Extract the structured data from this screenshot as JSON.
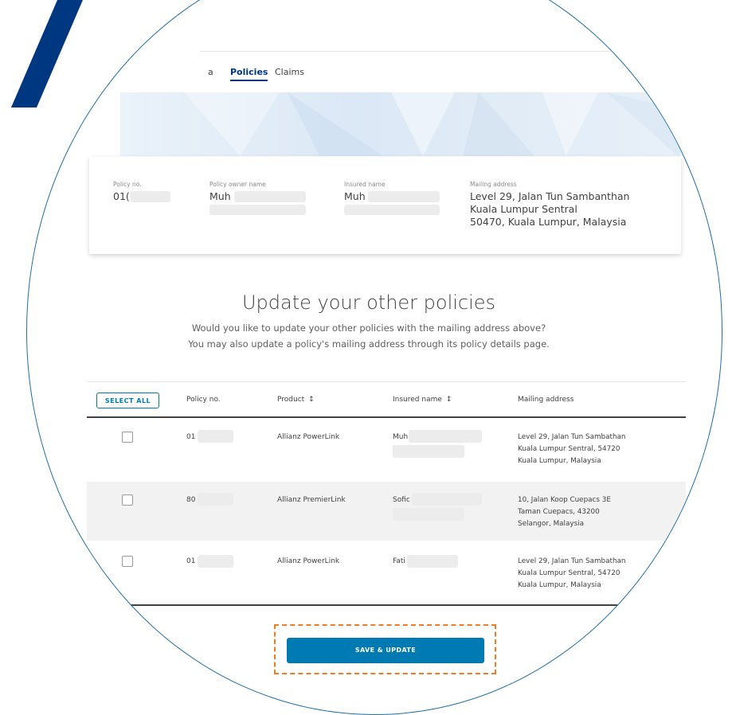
{
  "tabs": [
    {
      "label": "a",
      "active": false
    },
    {
      "label": "Policies",
      "active": true
    },
    {
      "label": "Claims",
      "active": false
    }
  ],
  "policy_card": {
    "policy_no_label": "Policy no.",
    "policy_no_value": "01(",
    "owner_label": "Policy owner name",
    "owner_value": "Muh",
    "insured_label": "Insured name",
    "insured_value": "Muh",
    "mailing_label": "Mailing address",
    "mailing_lines": [
      "Level 29, Jalan Tun Sambanthan",
      "Kuala Lumpur Sentral",
      "50470, Kuala Lumpur, Malaysia"
    ]
  },
  "update_section": {
    "heading": "Update your other policies",
    "line1": "Would you like to update your other policies with the mailing address above?",
    "line2": "You may also update a policy's mailing address through its policy details page."
  },
  "table": {
    "select_all_label": "SELECT ALL",
    "headers": {
      "policy_no": "Policy no.",
      "product": "Product",
      "insured_name": "Insured name",
      "mailing_address": "Mailing address"
    },
    "sort_icon": "sort-updown-icon",
    "rows": [
      {
        "policy_no": "01",
        "product": "Allianz PowerLink",
        "insured": "Muh",
        "address": [
          "Level 29, Jalan Tun Sambathan",
          "Kuala Lumpur Sentral, 54720",
          "Kuala Lumpur, Malaysia"
        ],
        "checked": false
      },
      {
        "policy_no": "80",
        "product": "Allianz PremierLink",
        "insured": "Sofic",
        "address": [
          "10, Jalan Koop Cuepacs 3E",
          "Taman Cuepacs, 43200",
          "Selangor, Malaysia"
        ],
        "checked": false
      },
      {
        "policy_no": "01",
        "product": "Allianz PowerLink",
        "insured": "Fati",
        "address": [
          "Level 29, Jalan Tun Sambathan",
          "Kuala Lumpur Sentral, 54720",
          "Kuala Lumpur, Malaysia"
        ],
        "checked": false
      }
    ]
  },
  "save_button_label": "SAVE & UPDATE",
  "colors": {
    "accent": "#007ab3",
    "brand": "#003781",
    "highlight": "#f07b21"
  }
}
